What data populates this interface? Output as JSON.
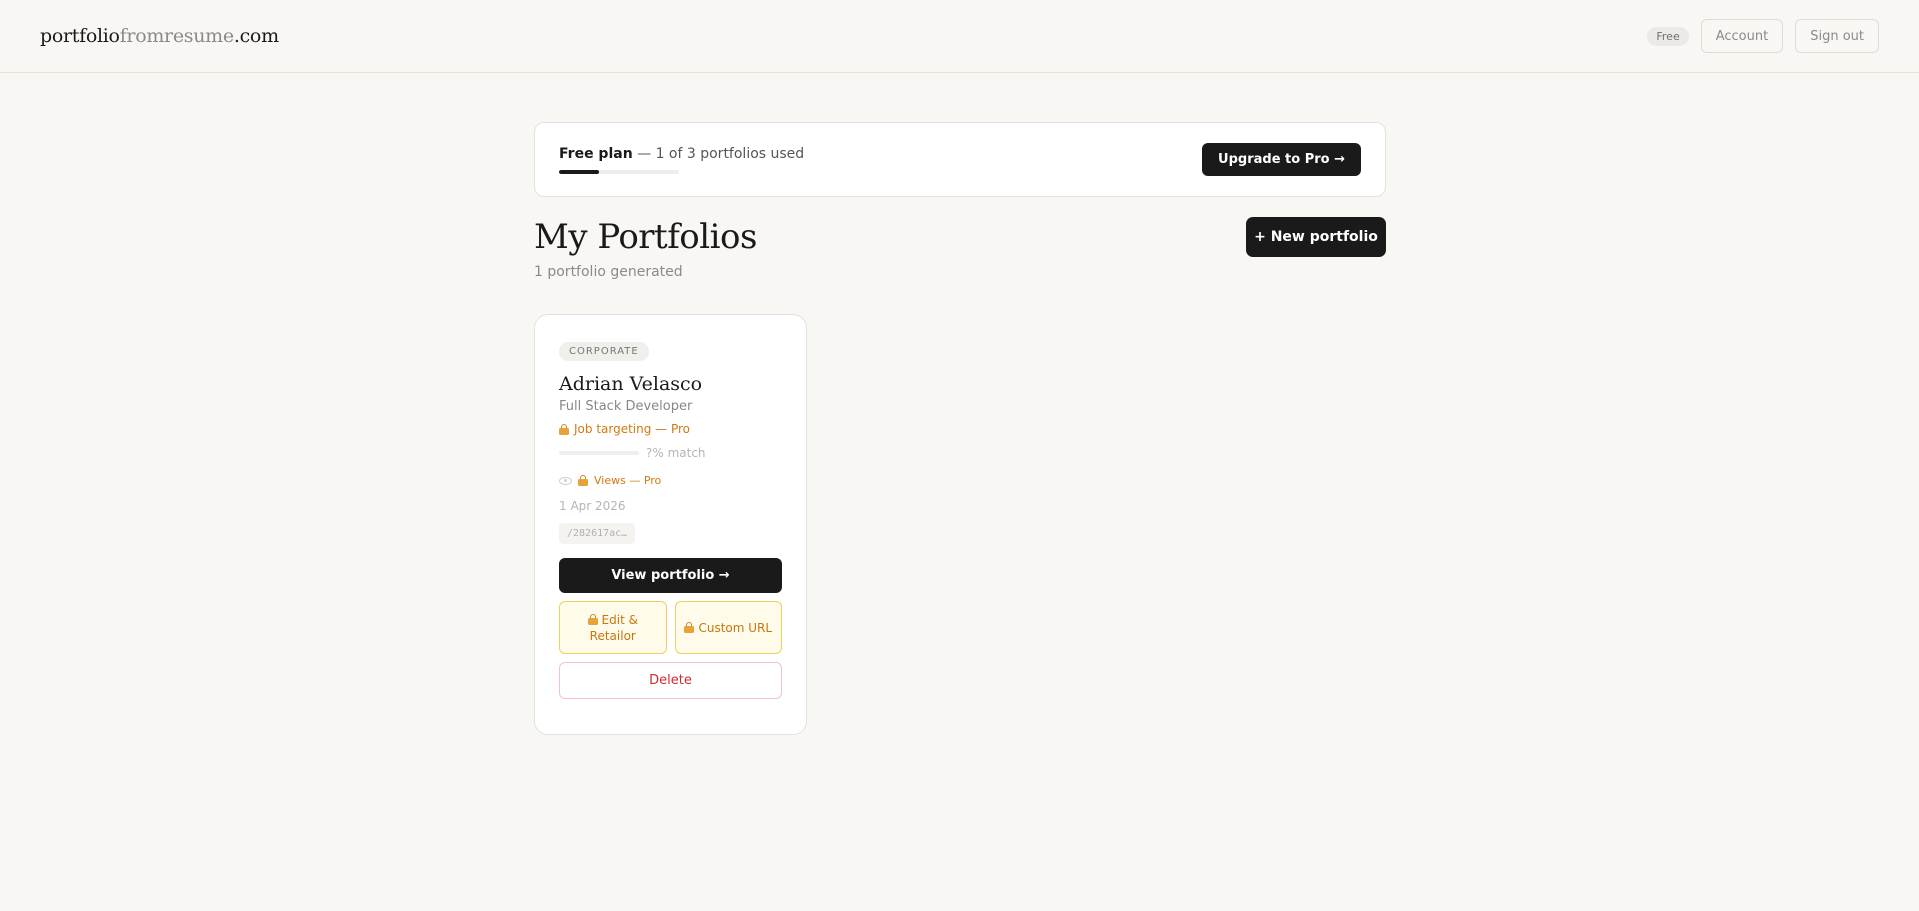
{
  "header": {
    "logo_part1": "portfolio",
    "logo_part2": "fromresume",
    "logo_part3": ".com",
    "plan_badge": "Free",
    "account_label": "Account",
    "signout_label": "Sign out"
  },
  "plan": {
    "name": "Free plan",
    "usage_text": "— 1 of 3 portfolios used",
    "used": 1,
    "total": 3,
    "upgrade_label": "Upgrade to Pro →"
  },
  "page": {
    "title": "My Portfolios",
    "subtitle": "1 portfolio generated",
    "new_button_label": "+ New portfolio"
  },
  "portfolio": {
    "tag": "CORPORATE",
    "name": "Adrian Velasco",
    "role": "Full Stack Developer",
    "job_targeting": "Job targeting — Pro",
    "match_text": "?% match",
    "views_text": "Views — Pro",
    "date": "1 Apr 2026",
    "slug": "/282617ac…",
    "view_label": "View portfolio →",
    "edit_label": "Edit & Retailor",
    "custom_url_label": "Custom URL",
    "delete_label": "Delete"
  },
  "colors": {
    "background": "#f8f7f4",
    "primary": "#1a1a1a",
    "pro_accent": "#d07a10",
    "danger": "#cc2b33"
  },
  "icons": {
    "lock": "lock-icon",
    "eye": "eye-icon"
  }
}
